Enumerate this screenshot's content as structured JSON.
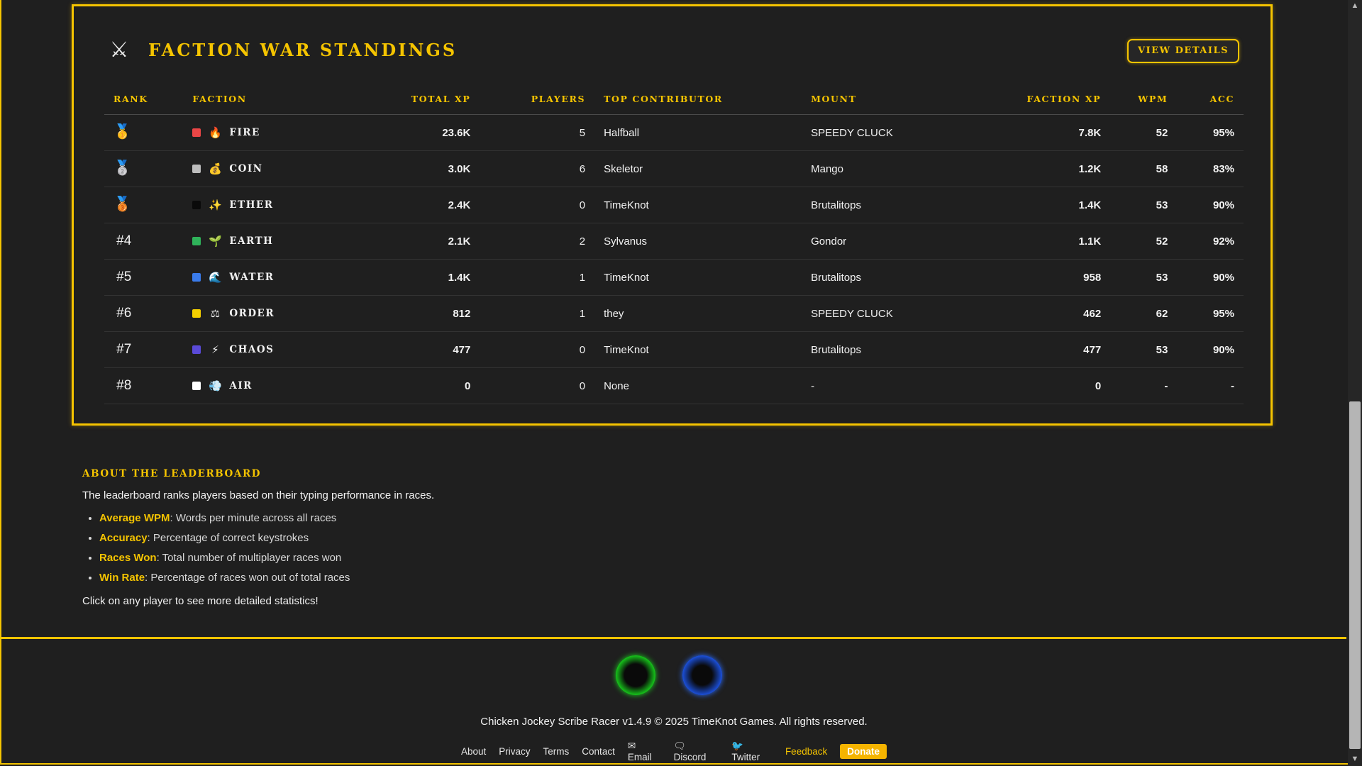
{
  "panel": {
    "title": "FACTION WAR STANDINGS",
    "title_icon": "crossed-swords-icon",
    "view_details_label": "VIEW DETAILS",
    "headers": {
      "rank": "RANK",
      "faction": "FACTION",
      "total_xp": "TOTAL XP",
      "players": "PLAYERS",
      "top_contributor": "TOP CONTRIBUTOR",
      "mount": "MOUNT",
      "faction_xp": "FACTION XP",
      "wpm": "WPM",
      "acc": "ACC"
    },
    "rows": [
      {
        "rank": "",
        "medal": "🥇",
        "medal_icon": "gold-medal-icon",
        "swatch": "#ea4646",
        "icon": "🔥",
        "icon_name": "fire-icon",
        "faction": "FIRE",
        "total_xp": "23.6K",
        "players": "5",
        "contributor": "Halfball",
        "mount": "SPEEDY CLUCK",
        "faction_xp": "7.8K",
        "wpm": "52",
        "acc": "95%"
      },
      {
        "rank": "",
        "medal": "🥈",
        "medal_icon": "silver-medal-icon",
        "swatch": "#bdbdbd",
        "icon": "💰",
        "icon_name": "coin-bag-icon",
        "faction": "COIN",
        "total_xp": "3.0K",
        "players": "6",
        "contributor": "Skeletor",
        "mount": "Mango",
        "faction_xp": "1.2K",
        "wpm": "58",
        "acc": "83%"
      },
      {
        "rank": "",
        "medal": "🥉",
        "medal_icon": "bronze-medal-icon",
        "swatch": "#0a0a0a",
        "icon": "✨",
        "icon_name": "sparkles-icon",
        "faction": "ETHER",
        "total_xp": "2.4K",
        "players": "0",
        "contributor": "TimeKnot",
        "mount": "Brutalitops",
        "faction_xp": "1.4K",
        "wpm": "53",
        "acc": "90%"
      },
      {
        "rank": "#4",
        "medal": "",
        "medal_icon": "",
        "swatch": "#2fb35a",
        "icon": "🌱",
        "icon_name": "seedling-icon",
        "faction": "EARTH",
        "total_xp": "2.1K",
        "players": "2",
        "contributor": "Sylvanus",
        "mount": "Gondor",
        "faction_xp": "1.1K",
        "wpm": "52",
        "acc": "92%"
      },
      {
        "rank": "#5",
        "medal": "",
        "medal_icon": "",
        "swatch": "#3a7bea",
        "icon": "🌊",
        "icon_name": "wave-icon",
        "faction": "WATER",
        "total_xp": "1.4K",
        "players": "1",
        "contributor": "TimeKnot",
        "mount": "Brutalitops",
        "faction_xp": "958",
        "wpm": "53",
        "acc": "90%"
      },
      {
        "rank": "#6",
        "medal": "",
        "medal_icon": "",
        "swatch": "#f5d000",
        "icon": "⚖",
        "icon_name": "scales-icon",
        "faction": "ORDER",
        "total_xp": "812",
        "players": "1",
        "contributor": "they",
        "mount": "SPEEDY CLUCK",
        "faction_xp": "462",
        "wpm": "62",
        "acc": "95%"
      },
      {
        "rank": "#7",
        "medal": "",
        "medal_icon": "",
        "swatch": "#5a4ad8",
        "icon": "⚡",
        "icon_name": "lightning-icon",
        "faction": "CHAOS",
        "total_xp": "477",
        "players": "0",
        "contributor": "TimeKnot",
        "mount": "Brutalitops",
        "faction_xp": "477",
        "wpm": "53",
        "acc": "90%"
      },
      {
        "rank": "#8",
        "medal": "",
        "medal_icon": "",
        "swatch": "#ffffff",
        "icon": "💨",
        "icon_name": "wind-icon",
        "faction": "AIR",
        "total_xp": "0",
        "players": "0",
        "contributor": "None",
        "mount": "-",
        "faction_xp": "0",
        "wpm": "-",
        "acc": "-"
      }
    ]
  },
  "about": {
    "heading": "ABOUT THE LEADERBOARD",
    "intro": "The leaderboard ranks players based on their typing performance in races.",
    "items": [
      {
        "term": "Average WPM",
        "desc": ": Words per minute across all races"
      },
      {
        "term": "Accuracy",
        "desc": ": Percentage of correct keystrokes"
      },
      {
        "term": "Races Won",
        "desc": ": Total number of multiplayer races won"
      },
      {
        "term": "Win Rate",
        "desc": ": Percentage of races won out of total races"
      }
    ],
    "outro": "Click on any player to see more detailed statistics!"
  },
  "footer": {
    "copyright": "Chicken Jockey Scribe Racer v1.4.9 © 2025 TimeKnot Games. All rights reserved.",
    "links": {
      "about": "About",
      "privacy": "Privacy",
      "terms": "Terms",
      "contact": "Contact",
      "email": "Email",
      "discord": "Discord",
      "twitter": "Twitter",
      "feedback": "Feedback",
      "donate": "Donate"
    }
  },
  "colors": {
    "accent": "#f5c400",
    "background": "#1f1f1f",
    "mount": "#f0a500",
    "faction_xp": "#ff8c2e",
    "wpm": "#4cd36a",
    "acc": "#4aa3ff"
  }
}
